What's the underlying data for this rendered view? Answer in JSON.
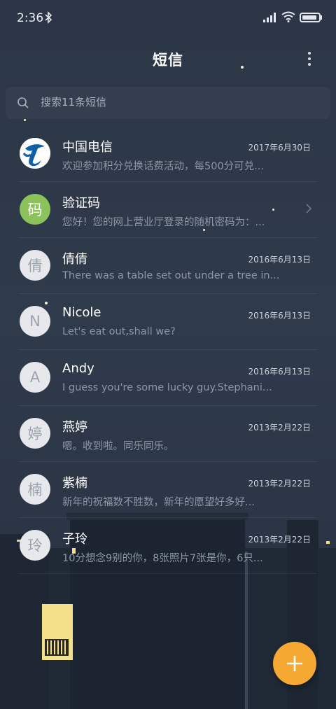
{
  "status_bar": {
    "time": "2:36"
  },
  "header": {
    "title": "短信"
  },
  "search": {
    "placeholder": "搜索11条短信"
  },
  "messages": [
    {
      "name": "中国电信",
      "date": "2017年6月30日",
      "preview": "欢迎参加积分兑换话费活动，每500分可兑...",
      "avatar": "",
      "avatar_icon": "china-telecom-logo"
    },
    {
      "name": "验证码",
      "date": "",
      "preview": "您好！您的网上营业厅登录的随机密码为：...",
      "avatar": "码"
    },
    {
      "name": "倩倩",
      "date": "2016年6月13日",
      "preview": "There was a table set out under a tree in...",
      "avatar": "倩"
    },
    {
      "name": "Nicole",
      "date": "2016年6月13日",
      "preview": "Let's eat out,shall we?",
      "avatar": "N"
    },
    {
      "name": "Andy",
      "date": "2016年6月13日",
      "preview": "I guess you're some lucky guy.Stephani...",
      "avatar": "A"
    },
    {
      "name": "燕婷",
      "date": "2013年2月22日",
      "preview": "嗯。收到啦。同乐同乐。",
      "avatar": "婷"
    },
    {
      "name": "紫楠",
      "date": "2013年2月22日",
      "preview": "新年的祝福数不胜数，新年的愿望好多好...",
      "avatar": "楠"
    },
    {
      "name": "子玲",
      "date": "2013年2月22日",
      "preview": "10分想念9别的你，8张照片7张是你，6只...",
      "avatar": "玲"
    }
  ],
  "colors": {
    "fab": "#f5a832",
    "verify_avatar": "#8bc25a",
    "telecom_blue": "#0f5fa9"
  },
  "fab": {
    "icon": "plus-icon"
  }
}
